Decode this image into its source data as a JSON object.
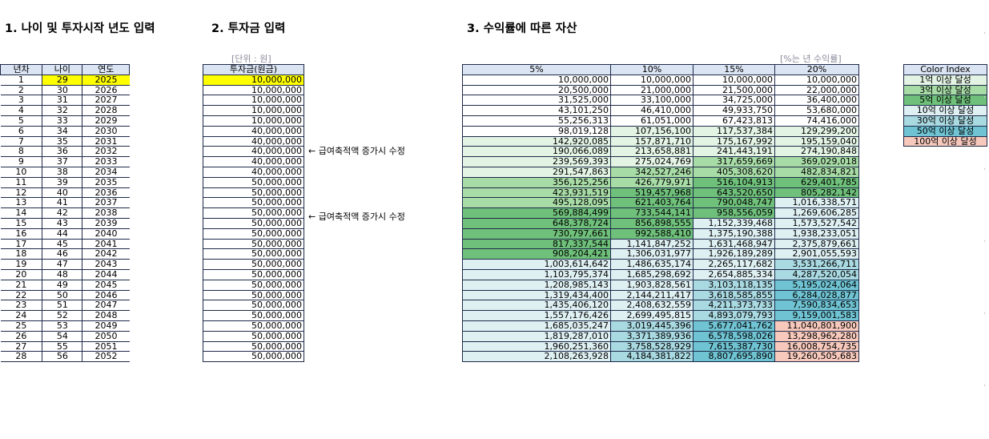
{
  "headers": {
    "section1": "1. 나이 및 투자시작 년도 입력",
    "section2": "2. 투자금 입력",
    "section3": "3. 수익률에 따른 자산"
  },
  "units": {
    "investment": "[단위 : 원]",
    "returns": "[%는 년 수익률]"
  },
  "table_basic": {
    "columns": [
      "년차",
      "나이",
      "연도"
    ],
    "rows": [
      [
        "1",
        "29",
        "2025"
      ],
      [
        "2",
        "30",
        "2026"
      ],
      [
        "3",
        "31",
        "2027"
      ],
      [
        "4",
        "32",
        "2028"
      ],
      [
        "5",
        "33",
        "2029"
      ],
      [
        "6",
        "34",
        "2030"
      ],
      [
        "7",
        "35",
        "2031"
      ],
      [
        "8",
        "36",
        "2032"
      ],
      [
        "9",
        "37",
        "2033"
      ],
      [
        "10",
        "38",
        "2034"
      ],
      [
        "11",
        "39",
        "2035"
      ],
      [
        "12",
        "40",
        "2036"
      ],
      [
        "13",
        "41",
        "2037"
      ],
      [
        "14",
        "42",
        "2038"
      ],
      [
        "15",
        "43",
        "2039"
      ],
      [
        "16",
        "44",
        "2040"
      ],
      [
        "17",
        "45",
        "2041"
      ],
      [
        "18",
        "46",
        "2042"
      ],
      [
        "19",
        "47",
        "2043"
      ],
      [
        "20",
        "48",
        "2044"
      ],
      [
        "21",
        "49",
        "2045"
      ],
      [
        "22",
        "50",
        "2046"
      ],
      [
        "23",
        "51",
        "2047"
      ],
      [
        "24",
        "52",
        "2048"
      ],
      [
        "25",
        "53",
        "2049"
      ],
      [
        "26",
        "54",
        "2050"
      ],
      [
        "27",
        "55",
        "2051"
      ],
      [
        "28",
        "56",
        "2052"
      ]
    ]
  },
  "table_investment": {
    "header": "투자금(원금)",
    "values": [
      "10,000,000",
      "10,000,000",
      "10,000,000",
      "10,000,000",
      "10,000,000",
      "40,000,000",
      "40,000,000",
      "40,000,000",
      "40,000,000",
      "40,000,000",
      "50,000,000",
      "50,000,000",
      "50,000,000",
      "50,000,000",
      "50,000,000",
      "50,000,000",
      "50,000,000",
      "50,000,000",
      "50,000,000",
      "50,000,000",
      "50,000,000",
      "50,000,000",
      "50,000,000",
      "50,000,000",
      "50,000,000",
      "50,000,000",
      "50,000,000",
      "50,000,000"
    ]
  },
  "notes": [
    {
      "text": "← 급여축적액 증가시 수정",
      "row": 6
    },
    {
      "text": "← 급여축적액 증가시 수정",
      "row": 11
    }
  ],
  "table_assets": {
    "columns": [
      "5%",
      "10%",
      "15%",
      "20%"
    ],
    "rows": [
      [
        "10,000,000",
        "10,000,000",
        "10,000,000",
        "10,000,000"
      ],
      [
        "20,500,000",
        "21,000,000",
        "21,500,000",
        "22,000,000"
      ],
      [
        "31,525,000",
        "33,100,000",
        "34,725,000",
        "36,400,000"
      ],
      [
        "43,101,250",
        "46,410,000",
        "49,933,750",
        "53,680,000"
      ],
      [
        "55,256,313",
        "61,051,000",
        "67,423,813",
        "74,416,000"
      ],
      [
        "98,019,128",
        "107,156,100",
        "117,537,384",
        "129,299,200"
      ],
      [
        "142,920,085",
        "157,871,710",
        "175,167,992",
        "195,159,040"
      ],
      [
        "190,066,089",
        "213,658,881",
        "241,443,191",
        "274,190,848"
      ],
      [
        "239,569,393",
        "275,024,769",
        "317,659,669",
        "369,029,018"
      ],
      [
        "291,547,863",
        "342,527,246",
        "405,308,620",
        "482,834,821"
      ],
      [
        "356,125,256",
        "426,779,971",
        "516,104,913",
        "629,401,785"
      ],
      [
        "423,931,519",
        "519,457,968",
        "643,520,650",
        "805,282,142"
      ],
      [
        "495,128,095",
        "621,403,764",
        "790,048,747",
        "1,016,338,571"
      ],
      [
        "569,884,499",
        "733,544,141",
        "958,556,059",
        "1,269,606,285"
      ],
      [
        "648,378,724",
        "856,898,555",
        "1,152,339,468",
        "1,573,527,542"
      ],
      [
        "730,797,661",
        "992,588,410",
        "1,375,190,388",
        "1,938,233,051"
      ],
      [
        "817,337,544",
        "1,141,847,252",
        "1,631,468,947",
        "2,375,879,661"
      ],
      [
        "908,204,421",
        "1,306,031,977",
        "1,926,189,289",
        "2,901,055,593"
      ],
      [
        "1,003,614,642",
        "1,486,635,174",
        "2,265,117,682",
        "3,531,266,711"
      ],
      [
        "1,103,795,374",
        "1,685,298,692",
        "2,654,885,334",
        "4,287,520,054"
      ],
      [
        "1,208,985,143",
        "1,903,828,561",
        "3,103,118,135",
        "5,195,024,064"
      ],
      [
        "1,319,434,400",
        "2,144,211,417",
        "3,618,585,855",
        "6,284,028,877"
      ],
      [
        "1,435,406,120",
        "2,408,632,559",
        "4,211,373,733",
        "7,590,834,653"
      ],
      [
        "1,557,176,426",
        "2,699,495,815",
        "4,893,079,793",
        "9,159,001,583"
      ],
      [
        "1,685,035,247",
        "3,019,445,396",
        "5,677,041,762",
        "11,040,801,900"
      ],
      [
        "1,819,287,010",
        "3,371,389,936",
        "6,578,598,026",
        "13,298,962,280"
      ],
      [
        "1,960,251,360",
        "3,758,528,929",
        "7,615,387,730",
        "16,008,754,735"
      ],
      [
        "2,108,263,928",
        "4,184,381,822",
        "8,807,695,890",
        "19,260,505,683"
      ]
    ]
  },
  "legend": {
    "title": "Color Index",
    "items": [
      {
        "label": "1억 이상 달성",
        "color": "#e3f4e4"
      },
      {
        "label": "3억 이상 달성",
        "color": "#a8dca6"
      },
      {
        "label": "5억 이상 달성",
        "color": "#6fc07a"
      },
      {
        "label": "10억 이상 달성",
        "color": "#dff0f3"
      },
      {
        "label": "30억 이상 달성",
        "color": "#a9d9e1"
      },
      {
        "label": "50억 이상 달성",
        "color": "#6fc3d2"
      },
      {
        "label": "100억 이상 달성",
        "color": "#f7c9bd"
      }
    ]
  },
  "colors": {
    "header_fill": "#dbe4f2",
    "input_highlight": "#ffff00",
    "border": "#1e2a4a"
  }
}
